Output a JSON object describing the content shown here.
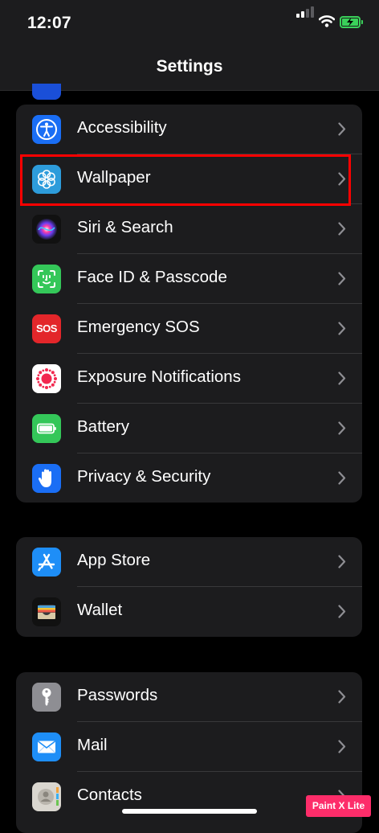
{
  "status_bar": {
    "time": "12:07"
  },
  "nav": {
    "title": "Settings"
  },
  "groups": [
    {
      "rows": [
        {
          "label": "Accessibility",
          "icon": "accessibility-icon"
        },
        {
          "label": "Wallpaper",
          "icon": "wallpaper-icon"
        },
        {
          "label": "Siri & Search",
          "icon": "siri-icon"
        },
        {
          "label": "Face ID & Passcode",
          "icon": "face-id-icon"
        },
        {
          "label": "Emergency SOS",
          "icon": "sos-icon",
          "icon_text": "SOS"
        },
        {
          "label": "Exposure Notifications",
          "icon": "exposure-notifications-icon"
        },
        {
          "label": "Battery",
          "icon": "battery-icon"
        },
        {
          "label": "Privacy & Security",
          "icon": "hand-icon"
        }
      ]
    },
    {
      "rows": [
        {
          "label": "App Store",
          "icon": "app-store-icon"
        },
        {
          "label": "Wallet",
          "icon": "wallet-icon"
        }
      ]
    },
    {
      "rows": [
        {
          "label": "Passwords",
          "icon": "key-icon"
        },
        {
          "label": "Mail",
          "icon": "mail-icon"
        },
        {
          "label": "Contacts",
          "icon": "contacts-icon"
        }
      ]
    }
  ],
  "highlighted_row": "Wallpaper",
  "watermark": "Paint X Lite",
  "colors": {
    "highlight": "#ff0000",
    "row_background": "#1c1c1e",
    "accessibility": "#1a6ef5",
    "wallpaper": "#2d9cdb",
    "face_id": "#34c759",
    "sos": "#e3262a",
    "battery": "#34c759",
    "privacy": "#1a6ef5",
    "app_store": "#1e8ef7",
    "passwords": "#8e8e93",
    "mail": "#1e8ef7"
  }
}
